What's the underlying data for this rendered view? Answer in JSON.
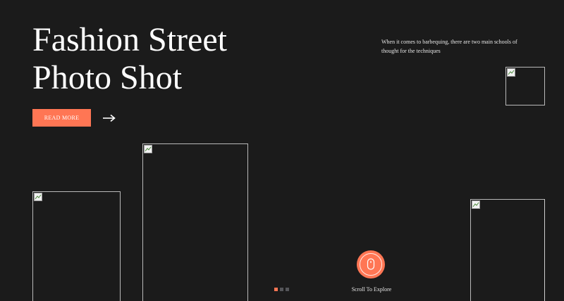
{
  "hero": {
    "title_line1": "Fashion Street",
    "title_line2": "Photo Shot",
    "read_more_label": "READ MORE",
    "arrow_icon": "arrow-right-icon"
  },
  "intro": {
    "text": "When it comes to barbequing, there are two main schools of thought for the techniques"
  },
  "gallery": {
    "icon": "broken-image-icon"
  },
  "pager": {
    "count": 3,
    "active_index": 0
  },
  "scroll": {
    "label": "Scroll To Explore",
    "icon": "mouse-icon"
  },
  "colors": {
    "background": "#1b1b1b",
    "accent": "#ff7654",
    "text": "#ffffff",
    "pager_inactive": "#55565a"
  }
}
